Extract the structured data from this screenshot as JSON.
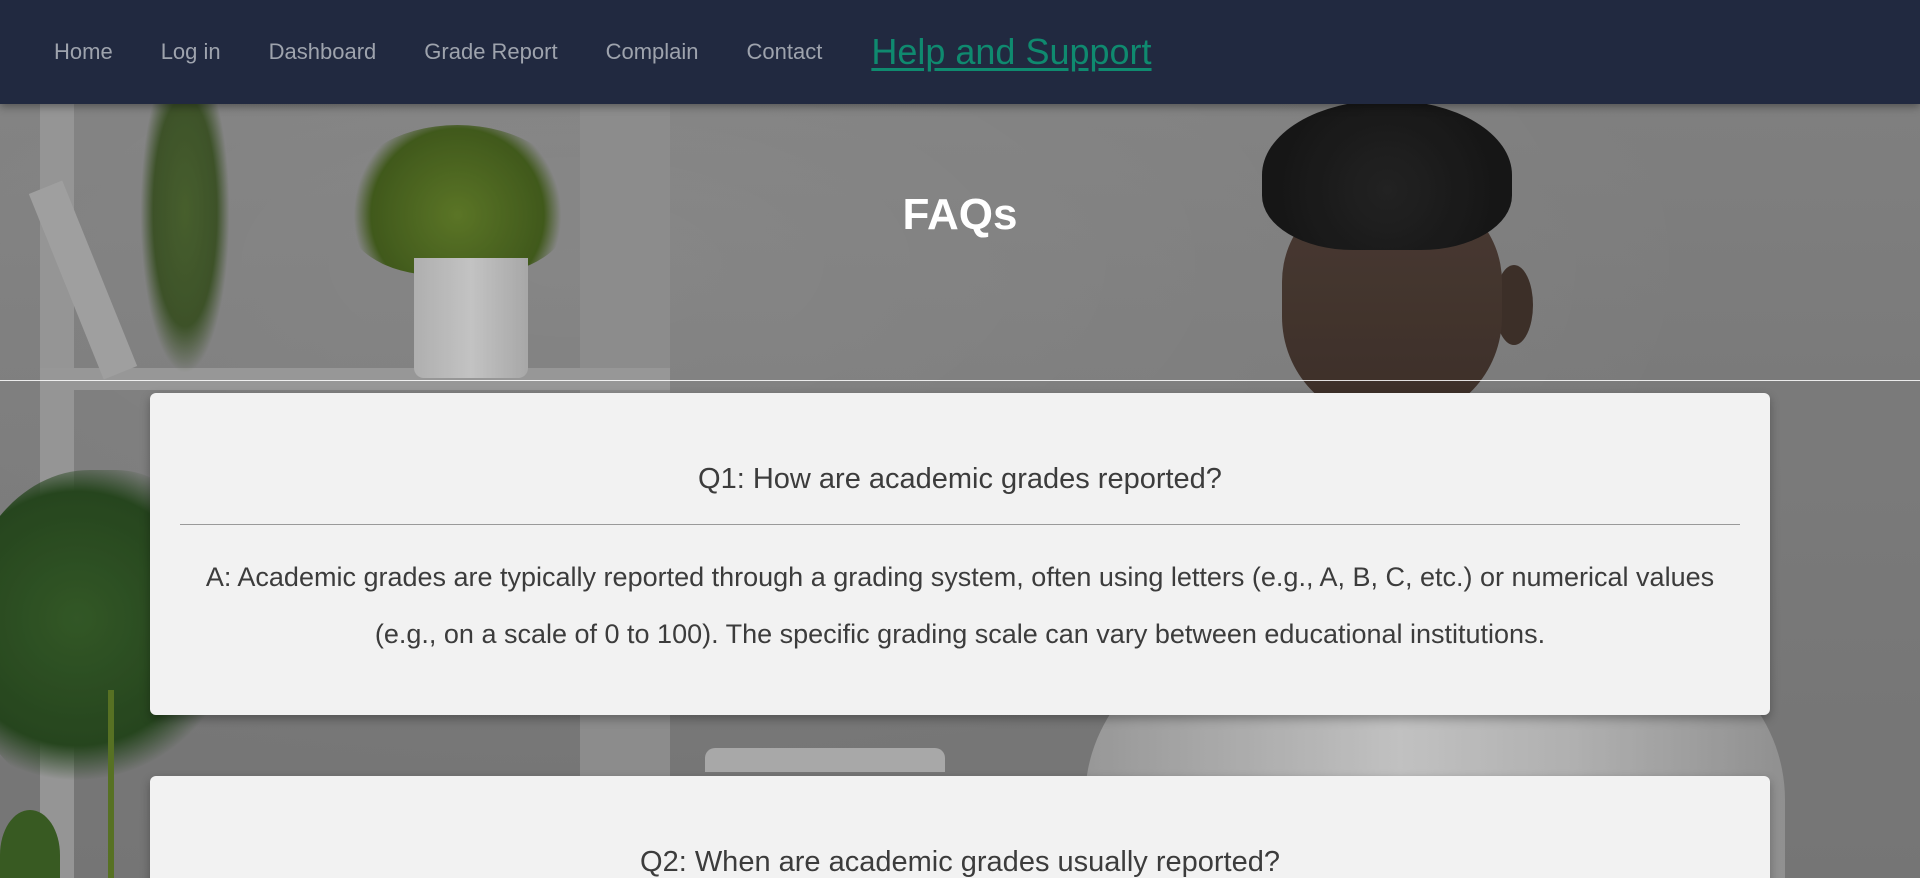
{
  "nav": {
    "items": [
      {
        "label": "Home"
      },
      {
        "label": "Log in"
      },
      {
        "label": "Dashboard"
      },
      {
        "label": "Grade Report"
      },
      {
        "label": "Complain"
      },
      {
        "label": "Contact"
      },
      {
        "label": "Help and Support",
        "active": true
      }
    ],
    "background_color": "#212940",
    "active_color": "#0f8a6f"
  },
  "hero": {
    "title": "FAQs"
  },
  "faqs": [
    {
      "question": "Q1: How are academic grades reported?",
      "answer": "A: Academic grades are typically reported through a grading system, often using letters (e.g., A, B, C, etc.) or numerical values (e.g., on a scale of 0 to 100). The specific grading scale can vary between educational institutions."
    },
    {
      "question": "Q2: When are academic grades usually reported?"
    }
  ]
}
